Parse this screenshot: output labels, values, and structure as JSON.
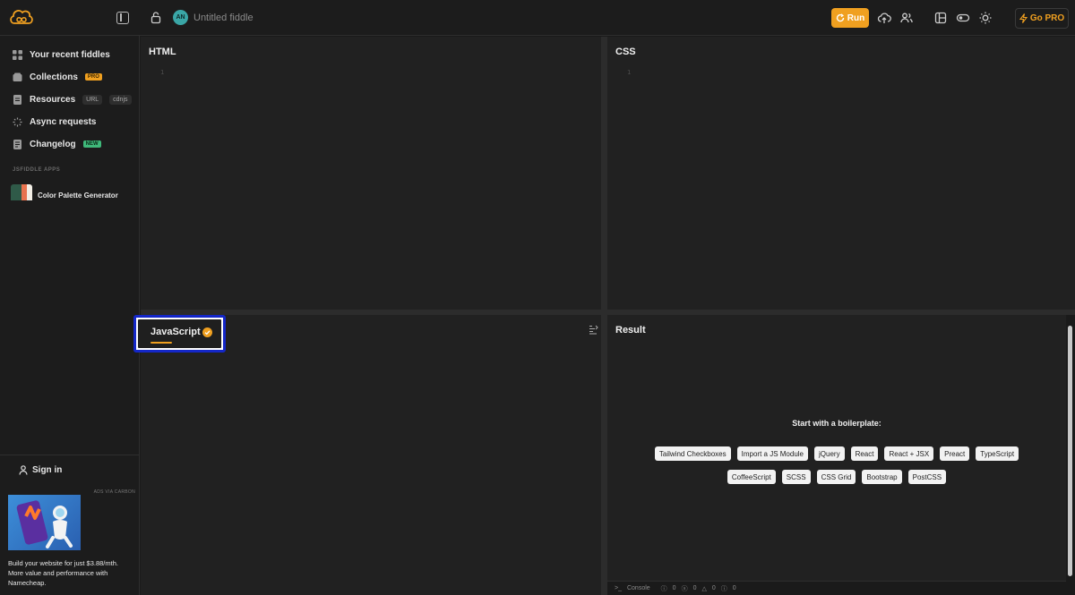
{
  "header": {
    "fiddle_title": "Untitled fiddle",
    "avatar_initials": "AN",
    "run_label": "Run",
    "go_pro_label": "Go PRO"
  },
  "sidebar": {
    "items": [
      {
        "label": "Your recent fiddles",
        "icon": "grid-icon"
      },
      {
        "label": "Collections",
        "badge": "PRO",
        "icon": "folder-icon"
      },
      {
        "label": "Resources",
        "tags": [
          "URL",
          "cdnjs"
        ],
        "icon": "file-icon"
      },
      {
        "label": "Async requests",
        "icon": "spinner-icon"
      },
      {
        "label": "Changelog",
        "badge": "NEW",
        "icon": "document-icon"
      }
    ],
    "apps_section_title": "JSFIDDLE APPS",
    "app_name": "Color Palette Generator",
    "signin_label": "Sign in",
    "ads_label": "ADS VIA CARBON",
    "ad_text": "Build your website for just $3.88/mth. More value and performance with Namecheap."
  },
  "panes": {
    "html_label": "HTML",
    "css_label": "CSS",
    "js_label": "JavaScript",
    "result_label": "Result",
    "line_number": "1"
  },
  "result": {
    "boilerplate_title": "Start with a boilerplate:",
    "row1": [
      "Tailwind Checkboxes",
      "Import a JS Module",
      "jQuery",
      "React",
      "React + JSX",
      "Preact",
      "TypeScript"
    ],
    "row2": [
      "CoffeeScript",
      "SCSS",
      "CSS Grid",
      "Bootstrap",
      "PostCSS"
    ]
  },
  "console": {
    "label": "Console",
    "counts": [
      "0",
      "0",
      "0",
      "0"
    ]
  },
  "colors": {
    "accent": "#f0a020",
    "highlight_border": "#1427c8"
  }
}
